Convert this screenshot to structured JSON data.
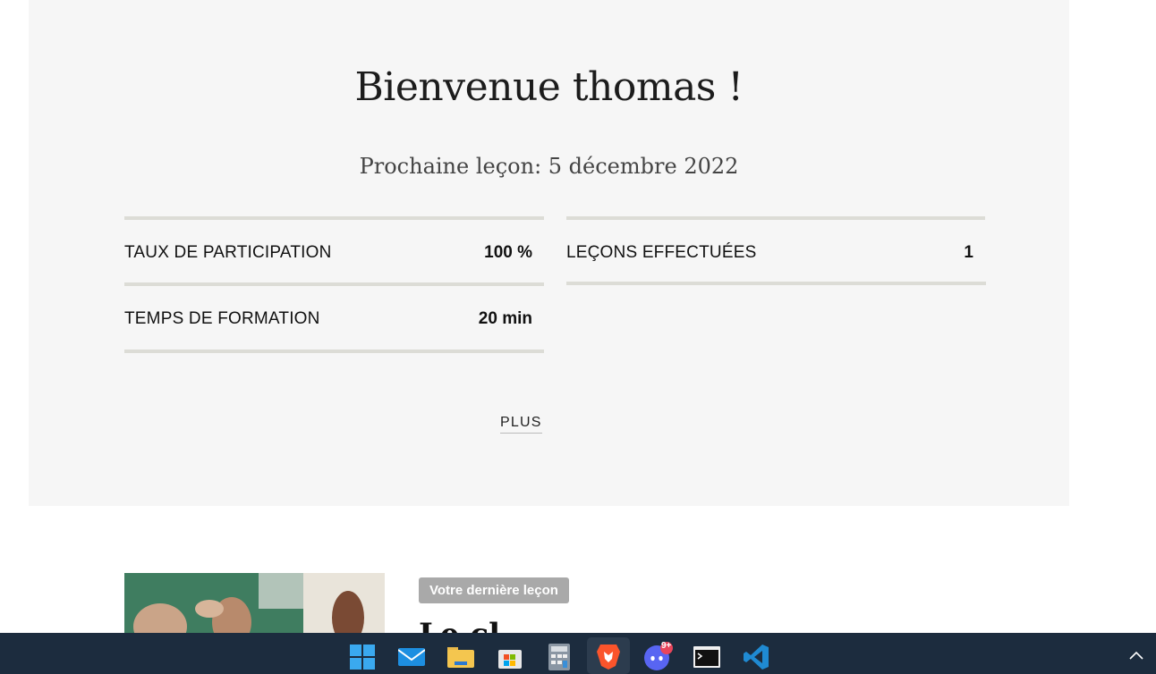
{
  "welcome": {
    "title": "Bienvenue thomas !",
    "next_lesson": "Prochaine leçon: 5 décembre 2022"
  },
  "stats": {
    "participation_label": "TAUX DE PARTICIPATION",
    "participation_value": "100 %",
    "lessons_label": "LEÇONS EFFECTUÉES",
    "lessons_value": "1",
    "time_label": "TEMPS DE FORMATION",
    "time_value": "20 min"
  },
  "more_link": "PLUS",
  "last_lesson": {
    "badge": "Votre dernière leçon",
    "title": "Le cl"
  },
  "taskbar": {
    "icons": [
      "windows-start-icon",
      "mail-icon",
      "file-explorer-icon",
      "microsoft-store-icon",
      "calculator-icon",
      "brave-browser-icon",
      "discord-icon",
      "terminal-icon",
      "vscode-icon"
    ],
    "discord_badge": "9+"
  },
  "colors": {
    "panel_bg": "#f6f6f6",
    "rule": "#dcdcd6",
    "taskbar": "#1c2c3e",
    "badge_bg": "#a9a9a9"
  }
}
